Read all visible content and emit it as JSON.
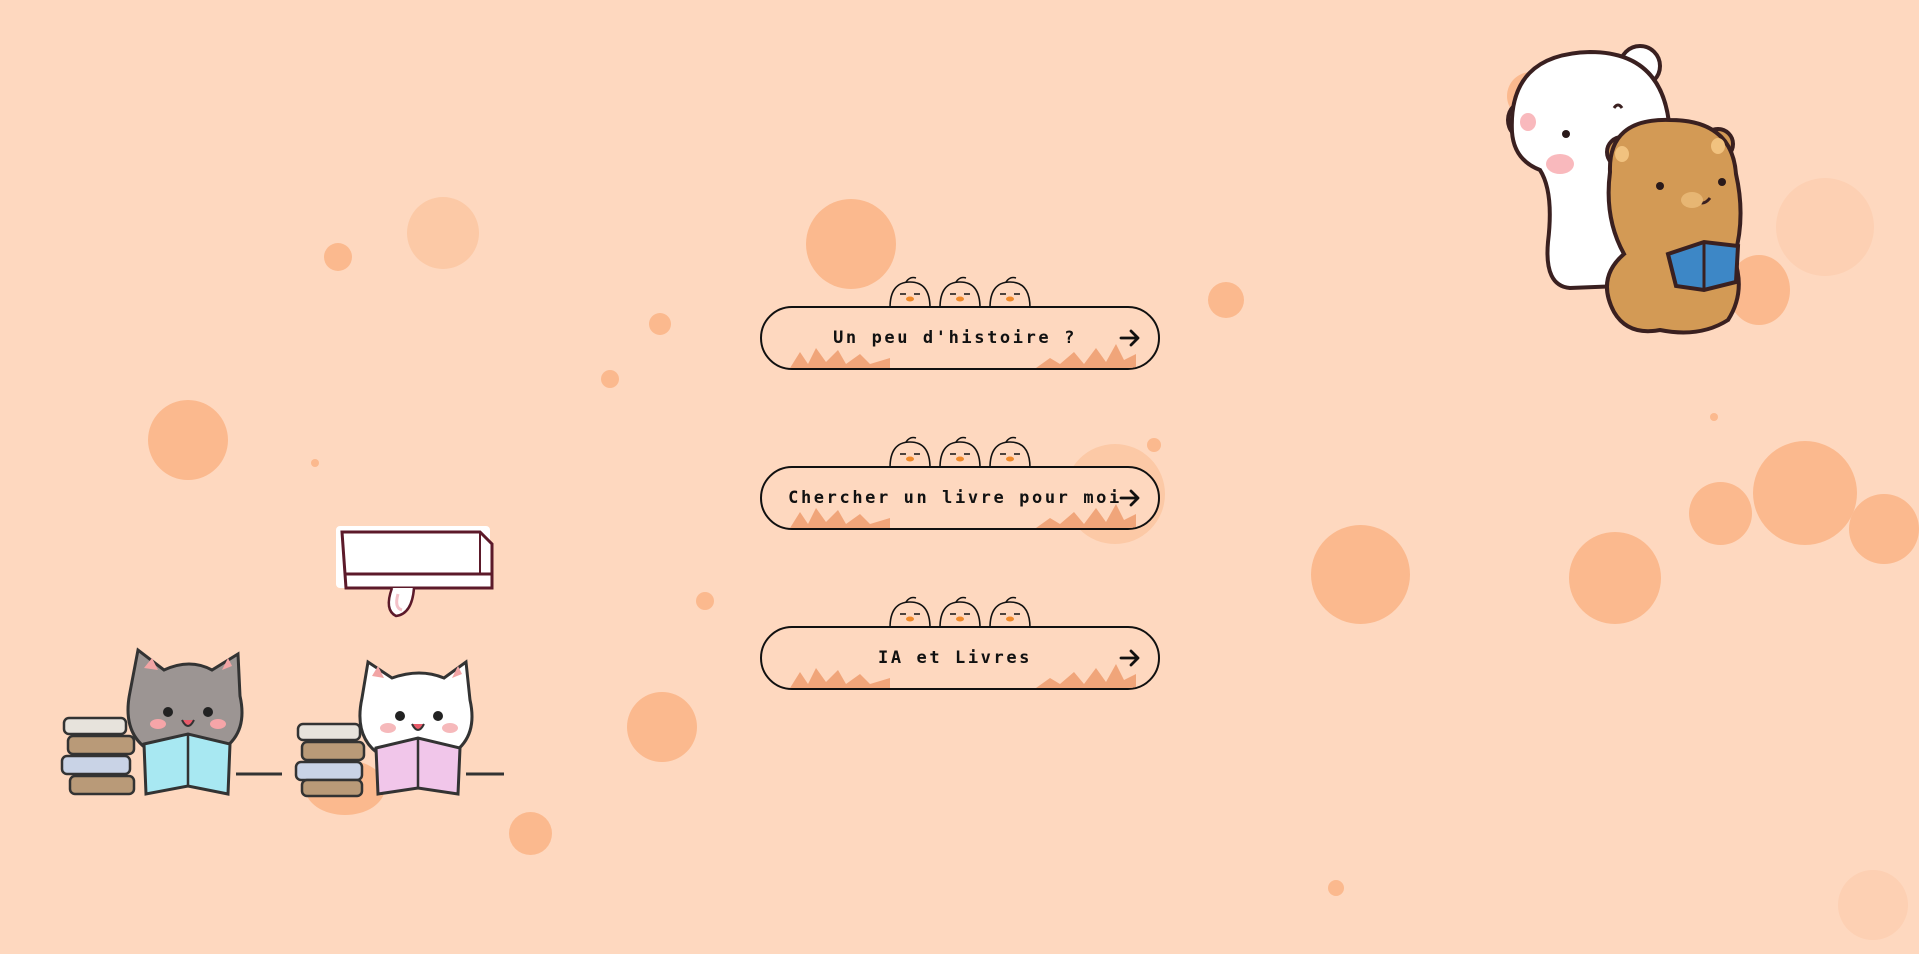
{
  "menu": {
    "items": [
      {
        "label": "Un peu d'histoire ?"
      },
      {
        "label": "Chercher un livre pour moi"
      },
      {
        "label": "IA et Livres"
      }
    ]
  },
  "decor": {
    "icons": [
      "bird-icon",
      "arrow-right-icon",
      "grass-icon"
    ],
    "stickers": [
      "bears-reading-illustration",
      "cats-reading-illustration",
      "speech-banner"
    ]
  },
  "colors": {
    "background": "#fed8bf",
    "bubble": "#fbb98e",
    "grass": "#f0a57a",
    "outline": "#111111"
  }
}
